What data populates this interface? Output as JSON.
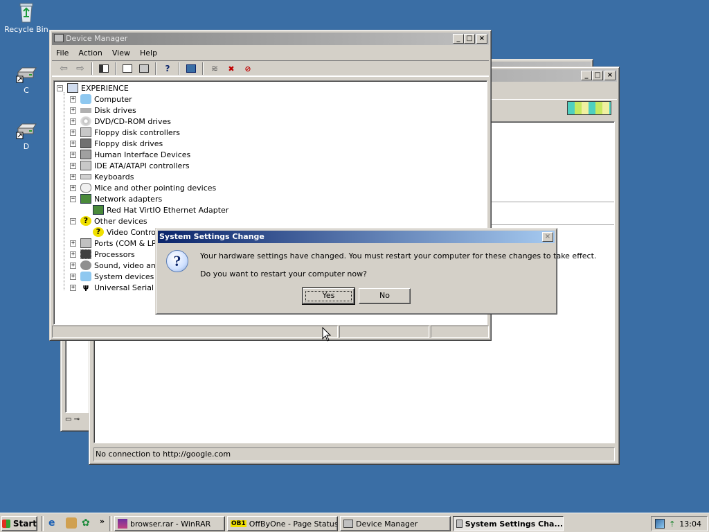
{
  "desktop": {
    "icons": [
      {
        "label": "Recycle Bin",
        "icon": "recycle-bin-icon"
      },
      {
        "label": "C",
        "icon": "drive-shortcut-icon"
      },
      {
        "label": "D",
        "icon": "drive-shortcut-icon"
      }
    ]
  },
  "browser_window": {
    "status_text": "No connection to http://google.com"
  },
  "device_manager": {
    "title": "Device Manager",
    "menu": [
      "File",
      "Action",
      "View",
      "Help"
    ],
    "tree": {
      "root": "EXPERIENCE",
      "items": [
        {
          "label": "Computer",
          "expanded": false
        },
        {
          "label": "Disk drives",
          "expanded": false
        },
        {
          "label": "DVD/CD-ROM drives",
          "expanded": false
        },
        {
          "label": "Floppy disk controllers",
          "expanded": false
        },
        {
          "label": "Floppy disk drives",
          "expanded": false
        },
        {
          "label": "Human Interface Devices",
          "expanded": false
        },
        {
          "label": "IDE ATA/ATAPI controllers",
          "expanded": false
        },
        {
          "label": "Keyboards",
          "expanded": false
        },
        {
          "label": "Mice and other pointing devices",
          "expanded": false
        },
        {
          "label": "Network adapters",
          "expanded": true
        },
        {
          "label": "Red Hat VirtIO Ethernet Adapter",
          "child": true
        },
        {
          "label": "Other devices",
          "expanded": true
        },
        {
          "label": "Video Controlle",
          "child": true
        },
        {
          "label": "Ports (COM & LPT)",
          "expanded": false
        },
        {
          "label": "Processors",
          "expanded": false
        },
        {
          "label": "Sound, video and g",
          "expanded": false
        },
        {
          "label": "System devices",
          "expanded": false
        },
        {
          "label": "Universal Serial Bu",
          "expanded": false
        }
      ]
    }
  },
  "dialog": {
    "title": "System Settings Change",
    "message": "Your hardware settings have changed. You must restart your computer for these changes to take effect.",
    "question": "Do you want to restart your computer now?",
    "yes_label": "Yes",
    "no_label": "No"
  },
  "taskbar": {
    "start_label": "Start",
    "tasks": [
      {
        "label": "browser.rar - WinRAR"
      },
      {
        "label": "OffByOne - Page Status",
        "badge": "OB1"
      },
      {
        "label": "Device Manager"
      },
      {
        "label": "System Settings Cha...",
        "active": true
      }
    ],
    "clock": "13:04"
  }
}
